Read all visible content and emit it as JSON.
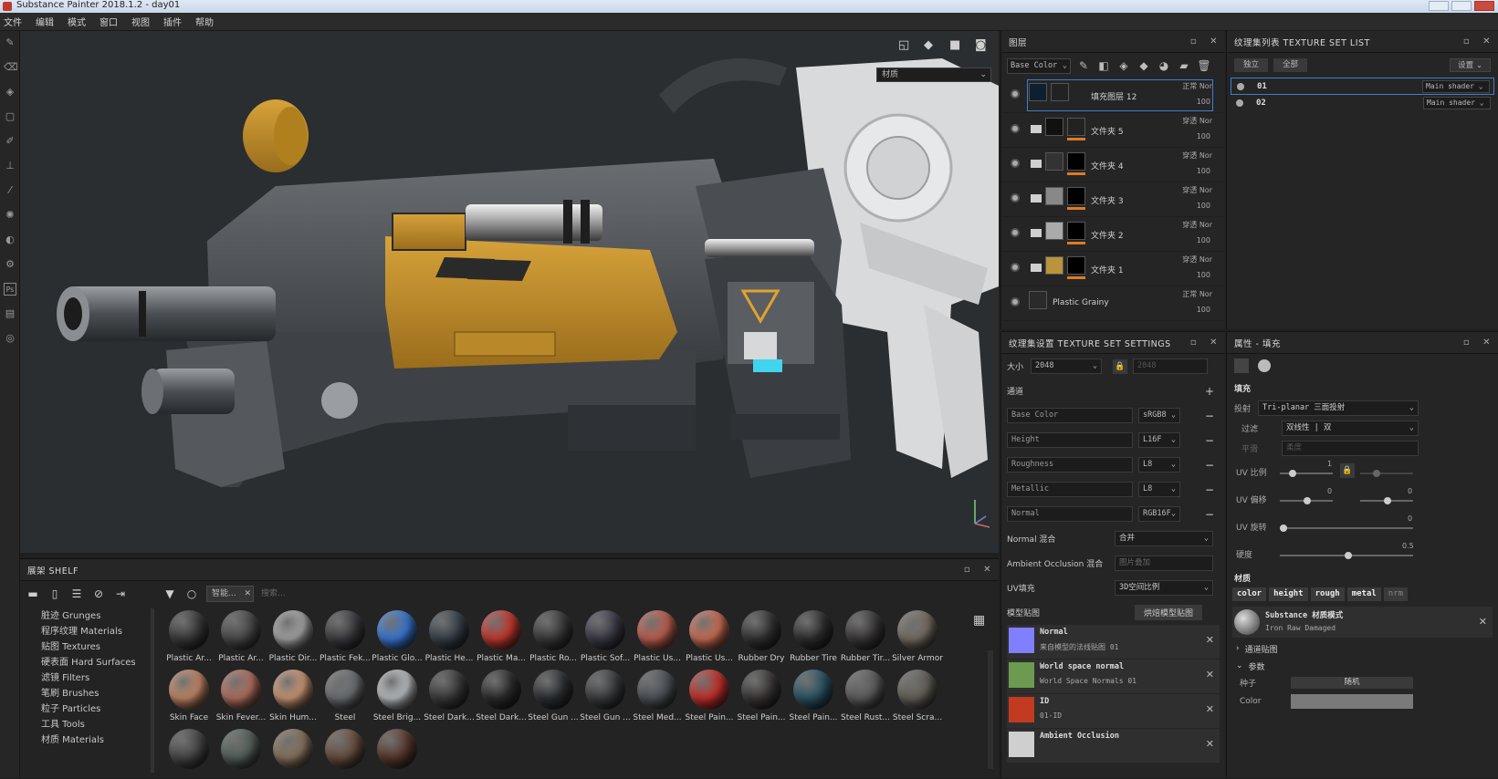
{
  "window": {
    "title": "Substance Painter 2018.1.2 - day01"
  },
  "menu": [
    "文件",
    "编辑",
    "模式",
    "窗口",
    "视图",
    "插件",
    "帮助"
  ],
  "viewport": {
    "material_mode": "材质"
  },
  "shelf": {
    "title": "展架 SHELF",
    "filter_tag": "智能...",
    "search_placeholder": "搜索...",
    "categories": [
      "脏迹 Grunges",
      "程序纹理 Materials",
      "贴图 Textures",
      "硬表面 Hard Surfaces",
      "滤镜 Filters",
      "笔刷 Brushes",
      "粒子 Particles",
      "工具 Tools",
      "材质 Materials"
    ],
    "materials": [
      {
        "label": "Plastic Ar...",
        "color": "#3a3a3a"
      },
      {
        "label": "Plastic Ar...",
        "color": "#4a4a4a"
      },
      {
        "label": "Plastic Dir...",
        "color": "#a8a8a8"
      },
      {
        "label": "Plastic Fek...",
        "color": "#3d3d42"
      },
      {
        "label": "Plastic Glo...",
        "color": "#3a79d8"
      },
      {
        "label": "Plastic He...",
        "color": "#36414a"
      },
      {
        "label": "Plastic Ma...",
        "color": "#c8392e"
      },
      {
        "label": "Plastic Ro...",
        "color": "#3a3a3a"
      },
      {
        "label": "Plastic Sof...",
        "color": "#3a3a48"
      },
      {
        "label": "Plastic Us...",
        "color": "#c26050"
      },
      {
        "label": "Plastic Us...",
        "color": "#d07055"
      },
      {
        "label": "Rubber Dry",
        "color": "#333333"
      },
      {
        "label": "Rubber Tire",
        "color": "#2e2e2e"
      },
      {
        "label": "Rubber Tir...",
        "color": "#3a3838"
      },
      {
        "label": "Silver Armor",
        "color": "#777066"
      },
      {
        "label": "Skin Face",
        "color": "#c88a68"
      },
      {
        "label": "Skin Fever...",
        "color": "#b77262"
      },
      {
        "label": "Skin Hum...",
        "color": "#d09a78"
      },
      {
        "label": "Steel",
        "color": "#6e7276"
      },
      {
        "label": "Steel Brig...",
        "color": "#bfc3c7"
      },
      {
        "label": "Steel Dark...",
        "color": "#3a3a3a"
      },
      {
        "label": "Steel Dark...",
        "color": "#2c2c2c"
      },
      {
        "label": "Steel Gun ...",
        "color": "#2c3034"
      },
      {
        "label": "Steel Gun ...",
        "color": "#3a3d40"
      },
      {
        "label": "Steel Med...",
        "color": "#4e5358"
      },
      {
        "label": "Steel Pain...",
        "color": "#c9302a"
      },
      {
        "label": "Steel Pain...",
        "color": "#3a3634"
      },
      {
        "label": "Steel Pain...",
        "color": "#2b5566"
      },
      {
        "label": "Steel Rust...",
        "color": "#5e5e5e"
      },
      {
        "label": "Steel Scra...",
        "color": "#66625a"
      },
      {
        "label": "",
        "color": "#484848"
      },
      {
        "label": "",
        "color": "#56625a"
      },
      {
        "label": "",
        "color": "#8a7660"
      },
      {
        "label": "",
        "color": "#6a5040"
      },
      {
        "label": "",
        "color": "#5a3a2c"
      }
    ]
  },
  "layers": {
    "title": "图层",
    "channel": "Base Color",
    "items": [
      {
        "name": "填充图层 12",
        "blend": "正常 Nor",
        "opacity": "100",
        "folder": false,
        "thumb": "#0d2030",
        "mask": "#222",
        "selected": true
      },
      {
        "name": "文件夹 5",
        "blend": "穿透 Nor",
        "opacity": "100",
        "folder": true,
        "thumb": "#111",
        "mask": "#222",
        "selected": false
      },
      {
        "name": "文件夹 4",
        "blend": "穿透 Nor",
        "opacity": "100",
        "folder": true,
        "thumb": "#333",
        "mask": "#000",
        "selected": false
      },
      {
        "name": "文件夹 3",
        "blend": "穿透 Nor",
        "opacity": "100",
        "folder": true,
        "thumb": "#888",
        "mask": "#000",
        "selected": false
      },
      {
        "name": "文件夹 2",
        "blend": "穿透 Nor",
        "opacity": "100",
        "folder": true,
        "thumb": "#aaa",
        "mask": "#000",
        "selected": false
      },
      {
        "name": "文件夹 1",
        "blend": "穿透 Nor",
        "opacity": "100",
        "folder": true,
        "thumb": "#b8943a",
        "mask": "#000",
        "selected": false
      },
      {
        "name": "Plastic Grainy",
        "blend": "正常 Nor",
        "opacity": "100",
        "folder": false,
        "thumb": "#2a2a2a",
        "mask": "",
        "selected": false
      }
    ]
  },
  "texture_set_list": {
    "title": "纹理集列表 TEXTURE SET LIST",
    "btn_solo": "独立",
    "btn_all": "全部",
    "btn_settings": "设置",
    "sets": [
      {
        "name": "01",
        "shader": "Main shader"
      },
      {
        "name": "02",
        "shader": "Main shader"
      }
    ]
  },
  "texture_set_settings": {
    "title": "纹理集设置 TEXTURE SET SETTINGS",
    "size_label": "大小",
    "size_value": "2048",
    "size_value2": "2048",
    "channels_label": "通道",
    "channels": [
      {
        "name": "Base Color",
        "format": "sRGB8"
      },
      {
        "name": "Height",
        "format": "L16F"
      },
      {
        "name": "Roughness",
        "format": "L8"
      },
      {
        "name": "Metallic",
        "format": "L8"
      },
      {
        "name": "Normal",
        "format": "RGB16F"
      }
    ],
    "normal_mix_label": "Normal 混合",
    "normal_mix_value": "合并",
    "ao_mix_label": "Ambient Occlusion 混合",
    "ao_mix_value": "图片叠加",
    "uv_fill_label": "UV填充",
    "uv_fill_value": "3D空间比例",
    "mesh_maps_label": "模型贴图",
    "bake_button": "烘焙模型贴图",
    "mesh_maps": [
      {
        "title": "Normal",
        "sub": "来自模型的法线贴图 01",
        "color": "#7f7fff"
      },
      {
        "title": "World space normal",
        "sub": "World Space Normals 01",
        "color": "#6c9a50"
      },
      {
        "title": "ID",
        "sub": "01-ID",
        "color": "#c23a20"
      },
      {
        "title": "Ambient Occlusion",
        "sub": "",
        "color": "#cfcfcf"
      }
    ]
  },
  "properties": {
    "title": "属性 - 填充",
    "fill_label": "填充",
    "projection_label": "投射",
    "projection_value": "Tri-planar 三面投射",
    "filter_label": "过滤",
    "filter_value": "双线性 | 双",
    "hardness_label": "平滑",
    "hardness_value": "柔度",
    "uv_scale_label": "UV 比例",
    "uv_scale_value": "1",
    "uv_offset_label": "UV 偏移",
    "uv_offset_value": "0",
    "uv_offset_value2": "0",
    "uv_rotate_label": "UV 旋转",
    "uv_rotate_value": "0",
    "hardness2_label": "硬度",
    "hardness2_value": "0.5",
    "material_label": "材质",
    "material_channels": [
      "color",
      "height",
      "rough",
      "metal",
      "nrm"
    ],
    "material_name": "Substance 材质模式",
    "material_sub": "Iron Raw Damaged",
    "channel_maps_label": "通道贴图",
    "params_label": "参数",
    "seed_label": "种子",
    "seed_value": "随机",
    "color_label": "Color"
  }
}
